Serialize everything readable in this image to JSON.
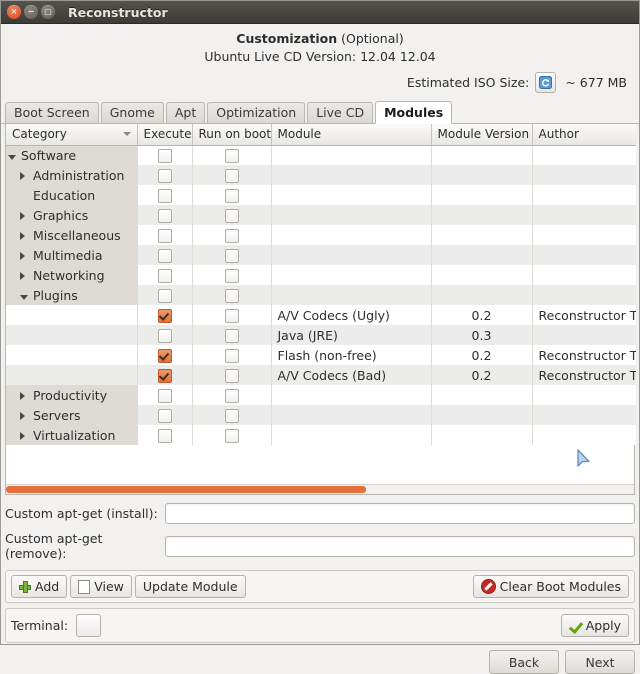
{
  "window": {
    "title": "Reconstructor",
    "controls": {
      "close": "×",
      "minimize": "−",
      "maximize": "□"
    }
  },
  "header": {
    "title_bold": "Customization",
    "title_suffix": " (Optional)",
    "subtitle": "Ubuntu Live CD Version: 12.04 12.04",
    "iso_label": "Estimated ISO Size:",
    "iso_size": "~ 677 MB",
    "refresh_icon": "refresh-icon"
  },
  "tabs": [
    {
      "label": "Boot Screen",
      "active": false
    },
    {
      "label": "Gnome",
      "active": false
    },
    {
      "label": "Apt",
      "active": false
    },
    {
      "label": "Optimization",
      "active": false
    },
    {
      "label": "Live CD",
      "active": false
    },
    {
      "label": "Modules",
      "active": true
    }
  ],
  "table": {
    "columns": [
      "Category",
      "Execute",
      "Run on boot",
      "Module",
      "Module Version",
      "Author"
    ],
    "sort_column": "Category",
    "sort_direction": "descending",
    "rows": [
      {
        "category": "Software",
        "indent": 0,
        "twisty": "open",
        "execute": false,
        "run_on_boot": false,
        "module": "",
        "version": "",
        "author": ""
      },
      {
        "category": "Administration",
        "indent": 1,
        "twisty": "closed",
        "execute": false,
        "run_on_boot": false,
        "module": "",
        "version": "",
        "author": ""
      },
      {
        "category": "Education",
        "indent": 1,
        "twisty": "none",
        "execute": false,
        "run_on_boot": false,
        "module": "",
        "version": "",
        "author": ""
      },
      {
        "category": "Graphics",
        "indent": 1,
        "twisty": "closed",
        "execute": false,
        "run_on_boot": false,
        "module": "",
        "version": "",
        "author": ""
      },
      {
        "category": "Miscellaneous",
        "indent": 1,
        "twisty": "closed",
        "execute": false,
        "run_on_boot": false,
        "module": "",
        "version": "",
        "author": ""
      },
      {
        "category": "Multimedia",
        "indent": 1,
        "twisty": "closed",
        "execute": false,
        "run_on_boot": false,
        "module": "",
        "version": "",
        "author": ""
      },
      {
        "category": "Networking",
        "indent": 1,
        "twisty": "closed",
        "execute": false,
        "run_on_boot": false,
        "module": "",
        "version": "",
        "author": ""
      },
      {
        "category": "Plugins",
        "indent": 1,
        "twisty": "open",
        "execute": false,
        "run_on_boot": false,
        "module": "",
        "version": "",
        "author": ""
      },
      {
        "category": "",
        "indent": 1,
        "twisty": "none",
        "execute": true,
        "run_on_boot": false,
        "module": "A/V Codecs (Ugly)",
        "version": "0.2",
        "author": "Reconstructor Tea"
      },
      {
        "category": "",
        "indent": 1,
        "twisty": "none",
        "execute": false,
        "run_on_boot": false,
        "module": "Java (JRE)",
        "version": "0.3",
        "author": ""
      },
      {
        "category": "",
        "indent": 1,
        "twisty": "none",
        "execute": true,
        "run_on_boot": false,
        "module": "Flash (non-free)",
        "version": "0.2",
        "author": "Reconstructor Tea"
      },
      {
        "category": "",
        "indent": 1,
        "twisty": "none",
        "execute": true,
        "run_on_boot": false,
        "module": "A/V Codecs (Bad)",
        "version": "0.2",
        "author": "Reconstructor Tea"
      },
      {
        "category": "Productivity",
        "indent": 1,
        "twisty": "closed",
        "execute": false,
        "run_on_boot": false,
        "module": "",
        "version": "",
        "author": ""
      },
      {
        "category": "Servers",
        "indent": 1,
        "twisty": "closed",
        "execute": false,
        "run_on_boot": false,
        "module": "",
        "version": "",
        "author": ""
      },
      {
        "category": "Virtualization",
        "indent": 1,
        "twisty": "closed",
        "execute": false,
        "run_on_boot": false,
        "module": "",
        "version": "",
        "author": ""
      }
    ]
  },
  "apt": {
    "install_label": "Custom apt-get (install):",
    "install_value": "",
    "install_placeholder": "",
    "remove_label": "Custom apt-get (remove):",
    "remove_value": "",
    "remove_placeholder": ""
  },
  "toolbar": {
    "add_label": "Add",
    "view_label": "View",
    "update_label": "Update Module",
    "clear_label": "Clear Boot Modules"
  },
  "terminal": {
    "label": "Terminal:",
    "checked": false,
    "apply_label": "Apply"
  },
  "nav": {
    "back_label": "Back",
    "next_label": "Next"
  },
  "colors": {
    "accent_orange": "#e4703a",
    "titlebar": "#3c3b37",
    "check_green": "#63a70a",
    "danger_red": "#c62828"
  }
}
